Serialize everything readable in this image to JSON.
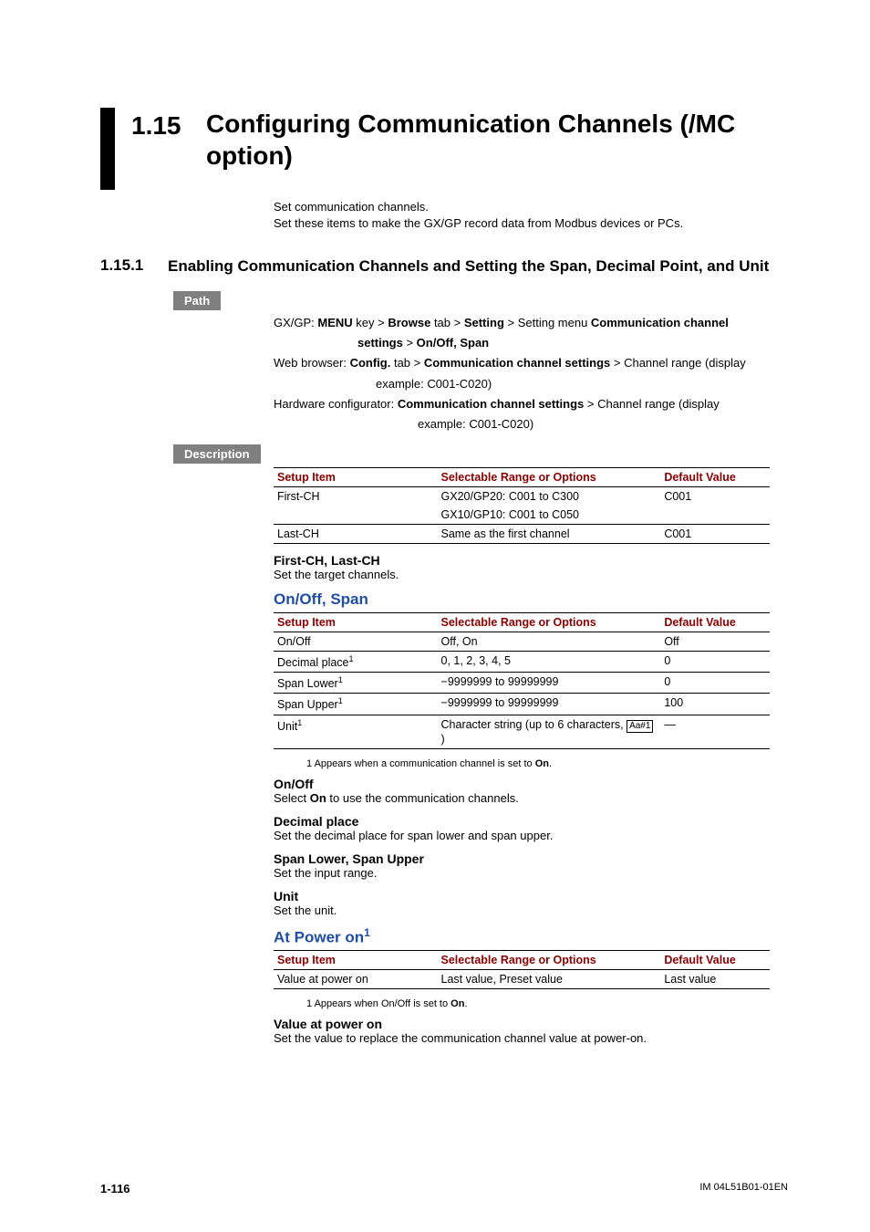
{
  "title": {
    "num": "1.15",
    "text": "Configuring Communication Channels (/MC option)"
  },
  "intro": {
    "l1": "Set communication channels.",
    "l2": "Set these items to make the GX/GP record data from Modbus devices or PCs."
  },
  "section": {
    "num": "1.15.1",
    "title": "Enabling Communication Channels and Setting the Span, Decimal Point, and Unit"
  },
  "labels": {
    "path": "Path",
    "description": "Description"
  },
  "path": {
    "p1a": "GX/GP: ",
    "p1b": "MENU",
    "p1c": " key > ",
    "p1d": "Browse",
    "p1e": " tab > ",
    "p1f": "Setting",
    "p1g": " > Setting menu ",
    "p1h": "Communication channel",
    "p2a": "settings",
    "p2b": " > ",
    "p2c": "On/Off, Span",
    "p3a": "Web browser: ",
    "p3b": "Config.",
    "p3c": " tab > ",
    "p3d": "Communication channel settings",
    "p3e": " > Channel range (display",
    "p4": "example: C001-C020)",
    "p5a": "Hardware configurator: ",
    "p5b": "Communication channel settings",
    "p5c": " > Channel range (display",
    "p6": "example: C001-C020)"
  },
  "th": {
    "item": "Setup Item",
    "range": "Selectable Range or Options",
    "default": "Default Value"
  },
  "table1": {
    "r1": {
      "c1": "First-CH",
      "c2a": "GX20/GP20: C001 to C300",
      "c2b": "GX10/GP10: C001 to C050",
      "c3": "C001"
    },
    "r2": {
      "c1": "Last-CH",
      "c2": "Same as the first channel",
      "c3": "C001"
    }
  },
  "firstlast": {
    "head": "First-CH, Last-CH",
    "text": "Set the target channels."
  },
  "onoffspan": {
    "head": "On/Off, Span"
  },
  "table2": {
    "r1": {
      "c1": "On/Off",
      "c2": "Off, On",
      "c3": "Off"
    },
    "r2": {
      "c1": "Decimal place",
      "sup": "1",
      "c2": "0, 1, 2, 3, 4, 5",
      "c3": "0"
    },
    "r3": {
      "c1": "Span Lower",
      "sup": "1",
      "c2": "−9999999 to 99999999",
      "c3": "0"
    },
    "r4": {
      "c1": "Span Upper",
      "sup": "1",
      "c2": "−9999999 to 99999999",
      "c3": "100"
    },
    "r5": {
      "c1": "Unit",
      "sup": "1",
      "c2": "Character string (up to 6 characters, ",
      "icon": "Aa#1",
      "c2b": ")",
      "c3": "—"
    }
  },
  "fn2": {
    "pre": "1   Appears when a communication channel is set to ",
    "b": "On",
    "post": "."
  },
  "onoff": {
    "head": "On/Off",
    "t1": "Select ",
    "b": "On",
    "t2": " to use the communication channels."
  },
  "decimal": {
    "head": "Decimal place",
    "text": "Set the decimal place for span lower and span upper."
  },
  "span": {
    "head": "Span Lower, Span Upper",
    "text": "Set the input range."
  },
  "unit": {
    "head": "Unit",
    "text": "Set the unit."
  },
  "atpower": {
    "head": "At Power on",
    "sup": "1"
  },
  "table3": {
    "r1": {
      "c1": "Value at power on",
      "c2": "Last value, Preset value",
      "c3": "Last value"
    }
  },
  "fn3": {
    "pre": "1   Appears when On/Off is set to ",
    "b": "On",
    "post": "."
  },
  "valuepower": {
    "head": "Value at power on",
    "text": "Set the value to replace the communication channel value at power-on."
  },
  "footer": {
    "page": "1-116",
    "doc": "IM 04L51B01-01EN"
  }
}
